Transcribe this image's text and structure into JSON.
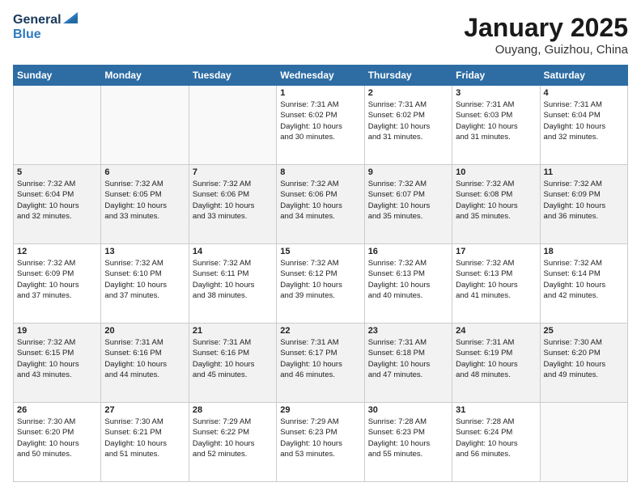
{
  "header": {
    "logo_line1": "General",
    "logo_line2": "Blue",
    "month_title": "January 2025",
    "location": "Ouyang, Guizhou, China"
  },
  "days_of_week": [
    "Sunday",
    "Monday",
    "Tuesday",
    "Wednesday",
    "Thursday",
    "Friday",
    "Saturday"
  ],
  "weeks": [
    {
      "shaded": false,
      "days": [
        {
          "num": "",
          "info": ""
        },
        {
          "num": "",
          "info": ""
        },
        {
          "num": "",
          "info": ""
        },
        {
          "num": "1",
          "info": "Sunrise: 7:31 AM\nSunset: 6:02 PM\nDaylight: 10 hours\nand 30 minutes."
        },
        {
          "num": "2",
          "info": "Sunrise: 7:31 AM\nSunset: 6:02 PM\nDaylight: 10 hours\nand 31 minutes."
        },
        {
          "num": "3",
          "info": "Sunrise: 7:31 AM\nSunset: 6:03 PM\nDaylight: 10 hours\nand 31 minutes."
        },
        {
          "num": "4",
          "info": "Sunrise: 7:31 AM\nSunset: 6:04 PM\nDaylight: 10 hours\nand 32 minutes."
        }
      ]
    },
    {
      "shaded": true,
      "days": [
        {
          "num": "5",
          "info": "Sunrise: 7:32 AM\nSunset: 6:04 PM\nDaylight: 10 hours\nand 32 minutes."
        },
        {
          "num": "6",
          "info": "Sunrise: 7:32 AM\nSunset: 6:05 PM\nDaylight: 10 hours\nand 33 minutes."
        },
        {
          "num": "7",
          "info": "Sunrise: 7:32 AM\nSunset: 6:06 PM\nDaylight: 10 hours\nand 33 minutes."
        },
        {
          "num": "8",
          "info": "Sunrise: 7:32 AM\nSunset: 6:06 PM\nDaylight: 10 hours\nand 34 minutes."
        },
        {
          "num": "9",
          "info": "Sunrise: 7:32 AM\nSunset: 6:07 PM\nDaylight: 10 hours\nand 35 minutes."
        },
        {
          "num": "10",
          "info": "Sunrise: 7:32 AM\nSunset: 6:08 PM\nDaylight: 10 hours\nand 35 minutes."
        },
        {
          "num": "11",
          "info": "Sunrise: 7:32 AM\nSunset: 6:09 PM\nDaylight: 10 hours\nand 36 minutes."
        }
      ]
    },
    {
      "shaded": false,
      "days": [
        {
          "num": "12",
          "info": "Sunrise: 7:32 AM\nSunset: 6:09 PM\nDaylight: 10 hours\nand 37 minutes."
        },
        {
          "num": "13",
          "info": "Sunrise: 7:32 AM\nSunset: 6:10 PM\nDaylight: 10 hours\nand 37 minutes."
        },
        {
          "num": "14",
          "info": "Sunrise: 7:32 AM\nSunset: 6:11 PM\nDaylight: 10 hours\nand 38 minutes."
        },
        {
          "num": "15",
          "info": "Sunrise: 7:32 AM\nSunset: 6:12 PM\nDaylight: 10 hours\nand 39 minutes."
        },
        {
          "num": "16",
          "info": "Sunrise: 7:32 AM\nSunset: 6:13 PM\nDaylight: 10 hours\nand 40 minutes."
        },
        {
          "num": "17",
          "info": "Sunrise: 7:32 AM\nSunset: 6:13 PM\nDaylight: 10 hours\nand 41 minutes."
        },
        {
          "num": "18",
          "info": "Sunrise: 7:32 AM\nSunset: 6:14 PM\nDaylight: 10 hours\nand 42 minutes."
        }
      ]
    },
    {
      "shaded": true,
      "days": [
        {
          "num": "19",
          "info": "Sunrise: 7:32 AM\nSunset: 6:15 PM\nDaylight: 10 hours\nand 43 minutes."
        },
        {
          "num": "20",
          "info": "Sunrise: 7:31 AM\nSunset: 6:16 PM\nDaylight: 10 hours\nand 44 minutes."
        },
        {
          "num": "21",
          "info": "Sunrise: 7:31 AM\nSunset: 6:16 PM\nDaylight: 10 hours\nand 45 minutes."
        },
        {
          "num": "22",
          "info": "Sunrise: 7:31 AM\nSunset: 6:17 PM\nDaylight: 10 hours\nand 46 minutes."
        },
        {
          "num": "23",
          "info": "Sunrise: 7:31 AM\nSunset: 6:18 PM\nDaylight: 10 hours\nand 47 minutes."
        },
        {
          "num": "24",
          "info": "Sunrise: 7:31 AM\nSunset: 6:19 PM\nDaylight: 10 hours\nand 48 minutes."
        },
        {
          "num": "25",
          "info": "Sunrise: 7:30 AM\nSunset: 6:20 PM\nDaylight: 10 hours\nand 49 minutes."
        }
      ]
    },
    {
      "shaded": false,
      "days": [
        {
          "num": "26",
          "info": "Sunrise: 7:30 AM\nSunset: 6:20 PM\nDaylight: 10 hours\nand 50 minutes."
        },
        {
          "num": "27",
          "info": "Sunrise: 7:30 AM\nSunset: 6:21 PM\nDaylight: 10 hours\nand 51 minutes."
        },
        {
          "num": "28",
          "info": "Sunrise: 7:29 AM\nSunset: 6:22 PM\nDaylight: 10 hours\nand 52 minutes."
        },
        {
          "num": "29",
          "info": "Sunrise: 7:29 AM\nSunset: 6:23 PM\nDaylight: 10 hours\nand 53 minutes."
        },
        {
          "num": "30",
          "info": "Sunrise: 7:28 AM\nSunset: 6:23 PM\nDaylight: 10 hours\nand 55 minutes."
        },
        {
          "num": "31",
          "info": "Sunrise: 7:28 AM\nSunset: 6:24 PM\nDaylight: 10 hours\nand 56 minutes."
        },
        {
          "num": "",
          "info": ""
        }
      ]
    }
  ]
}
